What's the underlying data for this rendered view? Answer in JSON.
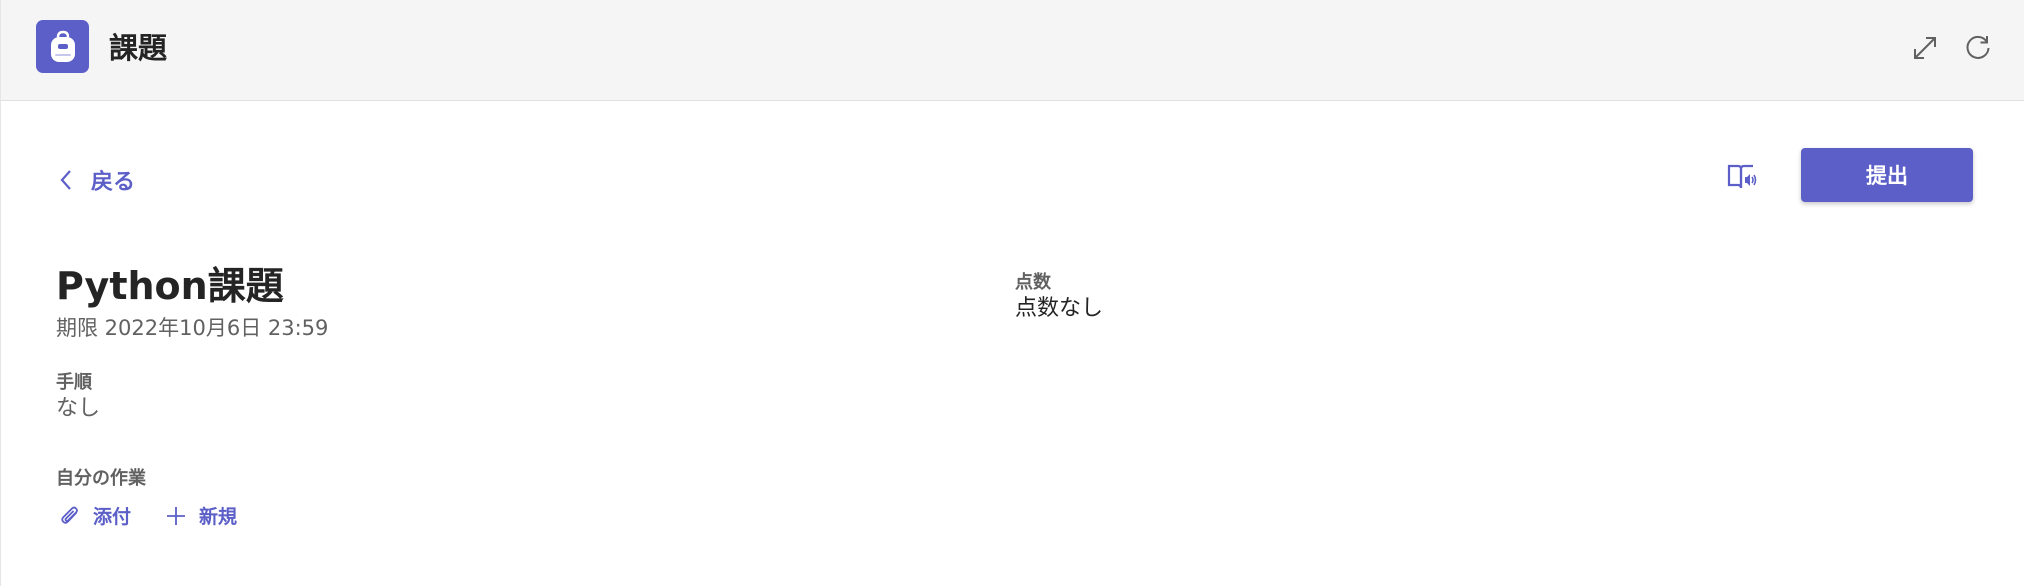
{
  "header": {
    "app_title": "課題",
    "app_icon": "backpack-icon",
    "expand_icon": "expand-icon",
    "refresh_icon": "refresh-icon"
  },
  "nav": {
    "back_label": "戻る"
  },
  "actions": {
    "immersive_reader_icon": "immersive-reader-icon",
    "submit_label": "提出"
  },
  "assignment": {
    "title": "Python課題",
    "due": "期限 2022年10月6日 23:59",
    "points_label": "点数",
    "points_value": "点数なし",
    "instructions_label": "手順",
    "instructions_value": "なし",
    "my_work_label": "自分の作業",
    "attach_label": "添付",
    "new_label": "新規"
  },
  "colors": {
    "accent": "#5b5fc7",
    "header_bg": "#f5f5f5",
    "text_primary": "#242424",
    "text_secondary": "#616161"
  }
}
